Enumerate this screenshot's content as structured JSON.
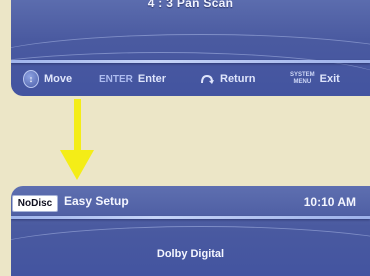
{
  "top_screen": {
    "current_option": "4 : 3 Pan Scan",
    "footer": {
      "move_label": "Move",
      "enter_key": "ENTER",
      "enter_label": "Enter",
      "return_label": "Return",
      "system_key_line1": "SYSTEM",
      "system_key_line2": "MENU",
      "exit_label": "Exit"
    }
  },
  "bottom_screen": {
    "disc_status": "NoDisc",
    "title": "Easy Setup",
    "clock": "10:10 AM",
    "item": "Dolby Digital"
  },
  "colors": {
    "arrow": "#f4ed17",
    "screen": "#4a5aa0",
    "background": "#ece6c7"
  }
}
